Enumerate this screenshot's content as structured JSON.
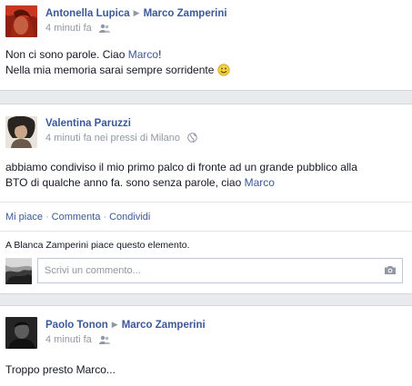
{
  "posts": [
    {
      "author": "Antonella Lupica",
      "target": "Marco Zamperini",
      "time": "4 minuti fa",
      "line1_prefix": "Non ci sono parole. Ciao ",
      "line1_link": "Marco",
      "line1_suffix": "!",
      "line2": "Nella mia memoria sarai sempre sorridente",
      "emoji": "☺"
    },
    {
      "author": "Valentina Paruzzi",
      "time": "4 minuti fa nei pressi di Milano",
      "line1": "abbiamo condiviso il mio primo palco di fronte ad un grande pubblico alla",
      "line2_prefix": "BTO di qualche anno fa. sono senza parole, ciao ",
      "line2_link": "Marco",
      "actions": [
        "Mi piace",
        "Commenta",
        "Condividi"
      ],
      "action_sep": "·",
      "likes_text": "A Blanca Zamperini piace questo elemento.",
      "comment_placeholder": "Scrivi un commento..."
    },
    {
      "author": "Paolo Tonon",
      "target": "Marco Zamperini",
      "time": "4 minuti fa",
      "text": "Troppo presto Marco..."
    }
  ],
  "icons": {
    "arrow": "right-triangle-icon",
    "audience": "friends-audience-icon",
    "globe": "globe-icon",
    "camera": "camera-icon"
  },
  "colors": {
    "link": "#3b5998",
    "meta": "#9197a3",
    "background": "#e9eaed"
  }
}
